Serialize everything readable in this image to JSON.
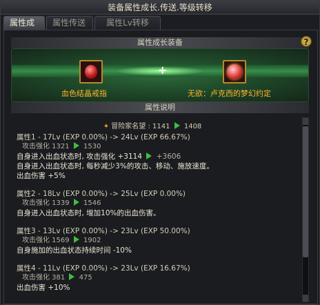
{
  "window": {
    "title": "装备属性成长.传送.等级转移"
  },
  "tabs": [
    {
      "label": "属性成长",
      "active": true
    },
    {
      "label": "属性传送",
      "active": false
    },
    {
      "label": "属性Lv转移",
      "active": false
    }
  ],
  "equip_section": {
    "header": "属性成长装备",
    "help_label": "?",
    "left_item": {
      "name": "血色结晶戒指",
      "icon": "red-crystal-ring-icon"
    },
    "plus": "+",
    "right_item": {
      "name": "无欲：卢克西的梦幻约定",
      "icon": "red-orb-icon"
    }
  },
  "desc_section": {
    "header": "属性说明",
    "reputation": {
      "label": "冒险家名望 : 1141",
      "to": "1408"
    },
    "attrs": [
      {
        "title": "属性1 - 17Lv (EXP 0.00%) -> 24Lv (EXP 66.67%)",
        "strength_from": "攻击强化 1321",
        "strength_to": "1530",
        "effects": [
          {
            "text": "自身进入出血状态时, 攻击强化 +3114",
            "to": "+3606"
          },
          {
            "text": "自身进入出血状态时, 每秒减少3%的攻击、移动、施放速度。"
          },
          {
            "text": "出血伤害 +5%"
          }
        ]
      },
      {
        "title": "属性2 - 18Lv (EXP 0.00%) -> 25Lv (EXP 0.00%)",
        "strength_from": "攻击强化 1339",
        "strength_to": "1546",
        "effects": [
          {
            "text": "自身进入出血状态时, 增加10%的出血伤害。"
          }
        ]
      },
      {
        "title": "属性3 - 13Lv (EXP 0.00%) -> 23Lv (EXP 50.00%)",
        "strength_from": "攻击强化 1569",
        "strength_to": "1902",
        "effects": [
          {
            "text": "自身施加的出血状态持续时间 -10%"
          }
        ]
      },
      {
        "title": "属性4 - 11Lv (EXP 0.00%) -> 23Lv (EXP 16.67%)",
        "strength_from": "攻击强化 381",
        "strength_to": "475",
        "effects": [
          {
            "text": "出血伤害 +10%"
          }
        ]
      }
    ]
  },
  "colors": {
    "accent_gold": "#ffb52a",
    "arrow_green": "#3fbf3f",
    "exp_green": "#4fd25a"
  }
}
